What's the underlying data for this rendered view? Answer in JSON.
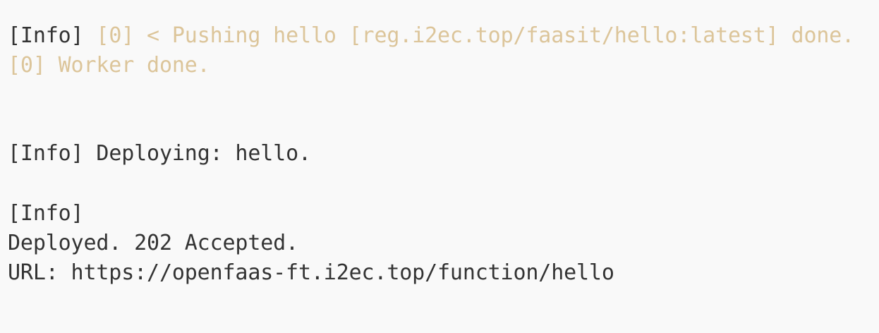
{
  "colors": {
    "background": "#f9f9f9",
    "normal_text": "#333333",
    "dim_text": "#dcc59a"
  },
  "log": {
    "line1": {
      "tag": "[Info]",
      "message": "[0] < Pushing hello [reg.i2ec.top/faasit/hello:latest] done."
    },
    "line2": {
      "message": "[0] Worker done."
    },
    "line3": {
      "tag": "[Info]",
      "message": "Deploying: hello."
    },
    "line4": {
      "tag": "[Info]"
    },
    "line5": {
      "message": "Deployed. 202 Accepted."
    },
    "line6": {
      "message": "URL: https://openfaas-ft.i2ec.top/function/hello"
    }
  }
}
